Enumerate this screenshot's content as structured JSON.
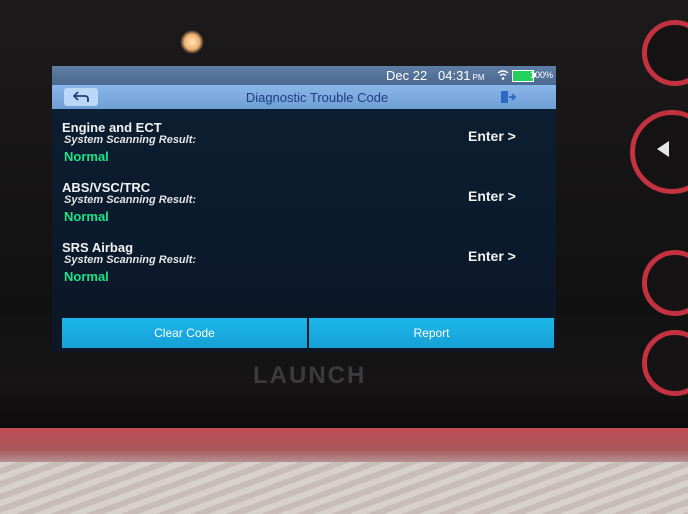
{
  "status_bar": {
    "date": "Dec 22",
    "time": "04:31",
    "ampm": "PM",
    "battery_percent": "100%",
    "wifi_icon": "wifi-icon",
    "battery_icon": "battery-icon"
  },
  "header": {
    "back_icon": "back-arrow-icon",
    "title": "Diagnostic Trouble Code",
    "exit_icon": "exit-icon"
  },
  "systems": [
    {
      "name": "Engine and ECT",
      "subtitle": "System Scanning Result:",
      "status": "Normal",
      "action": "Enter >"
    },
    {
      "name": "ABS/VSC/TRC",
      "subtitle": "System Scanning Result:",
      "status": "Normal",
      "action": "Enter >"
    },
    {
      "name": "SRS Airbag",
      "subtitle": "System Scanning Result:",
      "status": "Normal",
      "action": "Enter >"
    }
  ],
  "actions": {
    "clear_code": "Clear Code",
    "report": "Report"
  },
  "device": {
    "brand": "LAUNCH"
  },
  "colors": {
    "status_normal": "#19e38a",
    "button_blue": "#1db6e8",
    "title_blue": "#6f9fd6"
  }
}
